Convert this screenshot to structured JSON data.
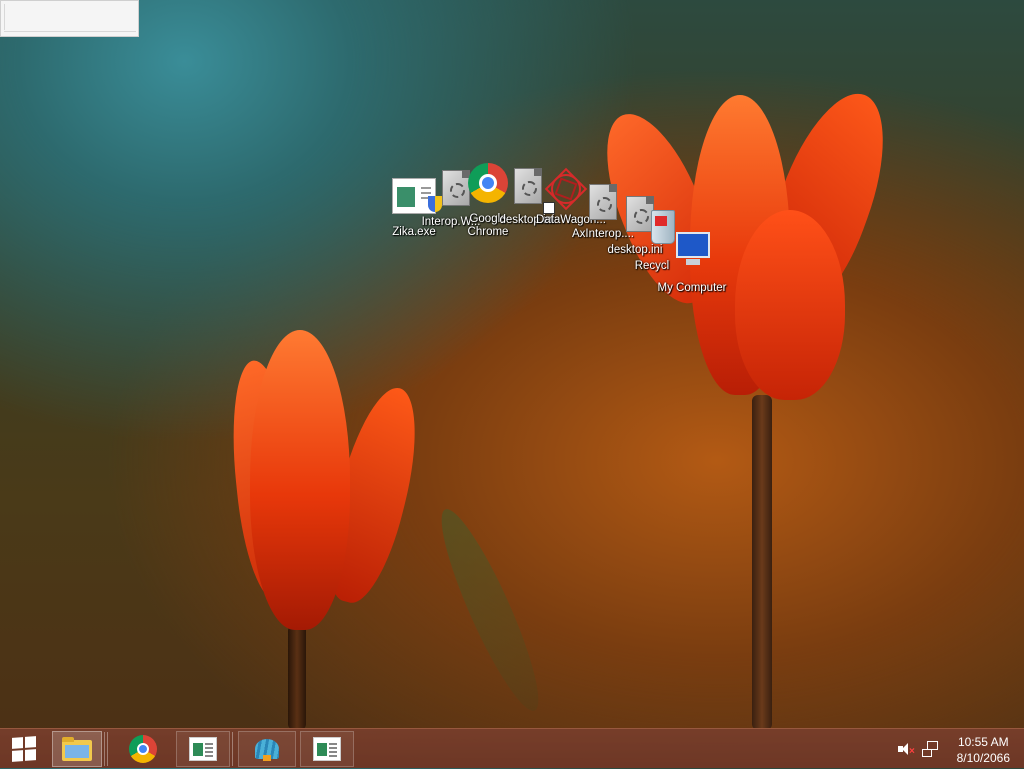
{
  "desktop": {
    "icons": [
      {
        "label": "Zika.exe"
      },
      {
        "label": "Interop.W..."
      },
      {
        "label": "Google Chrome"
      },
      {
        "label": "desktop.ini"
      },
      {
        "label": "DataWagon..."
      },
      {
        "label": "AxInterop...."
      },
      {
        "label": "desktop.ini"
      },
      {
        "label": "Recycl"
      },
      {
        "label": "My Computer"
      }
    ]
  },
  "taskbar": {
    "items": [
      {
        "name": "start-button",
        "icon": "windows-logo-icon"
      },
      {
        "name": "file-explorer",
        "icon": "folder-icon"
      },
      {
        "name": "google-chrome",
        "icon": "chrome-icon"
      },
      {
        "name": "app-window-1",
        "icon": "app-window-icon"
      },
      {
        "name": "shell-app",
        "icon": "shell-icon"
      },
      {
        "name": "app-window-2",
        "icon": "app-window-icon"
      }
    ],
    "tray": {
      "volume_icon": "volume-muted-icon",
      "network_icon": "network-icon"
    },
    "clock": {
      "time": "10:55 AM",
      "date": "8/10/2066"
    }
  },
  "colors": {
    "taskbar": "#7a3e2c",
    "tulip": "#ff4a12",
    "chrome_red": "#db4437",
    "chrome_green": "#0f9d58",
    "chrome_yellow": "#f4b400",
    "chrome_blue": "#4285f4"
  }
}
